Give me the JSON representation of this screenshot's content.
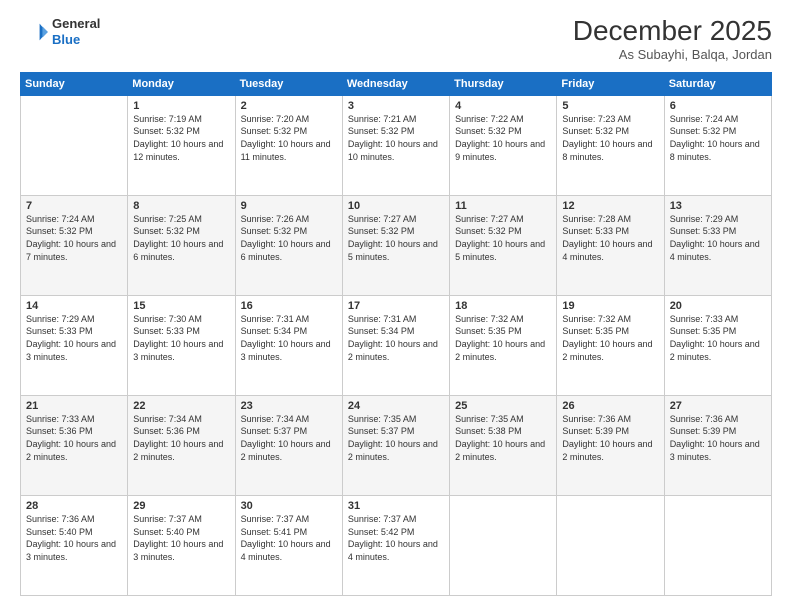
{
  "logo": {
    "line1": "General",
    "line2": "Blue"
  },
  "title": "December 2025",
  "location": "As Subayhi, Balqa, Jordan",
  "days_header": [
    "Sunday",
    "Monday",
    "Tuesday",
    "Wednesday",
    "Thursday",
    "Friday",
    "Saturday"
  ],
  "weeks": [
    [
      {
        "day": "",
        "sunrise": "",
        "sunset": "",
        "daylight": ""
      },
      {
        "day": "1",
        "sunrise": "7:19 AM",
        "sunset": "5:32 PM",
        "daylight": "10 hours and 12 minutes."
      },
      {
        "day": "2",
        "sunrise": "7:20 AM",
        "sunset": "5:32 PM",
        "daylight": "10 hours and 11 minutes."
      },
      {
        "day": "3",
        "sunrise": "7:21 AM",
        "sunset": "5:32 PM",
        "daylight": "10 hours and 10 minutes."
      },
      {
        "day": "4",
        "sunrise": "7:22 AM",
        "sunset": "5:32 PM",
        "daylight": "10 hours and 9 minutes."
      },
      {
        "day": "5",
        "sunrise": "7:23 AM",
        "sunset": "5:32 PM",
        "daylight": "10 hours and 8 minutes."
      },
      {
        "day": "6",
        "sunrise": "7:24 AM",
        "sunset": "5:32 PM",
        "daylight": "10 hours and 8 minutes."
      }
    ],
    [
      {
        "day": "7",
        "sunrise": "7:24 AM",
        "sunset": "5:32 PM",
        "daylight": "10 hours and 7 minutes."
      },
      {
        "day": "8",
        "sunrise": "7:25 AM",
        "sunset": "5:32 PM",
        "daylight": "10 hours and 6 minutes."
      },
      {
        "day": "9",
        "sunrise": "7:26 AM",
        "sunset": "5:32 PM",
        "daylight": "10 hours and 6 minutes."
      },
      {
        "day": "10",
        "sunrise": "7:27 AM",
        "sunset": "5:32 PM",
        "daylight": "10 hours and 5 minutes."
      },
      {
        "day": "11",
        "sunrise": "7:27 AM",
        "sunset": "5:32 PM",
        "daylight": "10 hours and 5 minutes."
      },
      {
        "day": "12",
        "sunrise": "7:28 AM",
        "sunset": "5:33 PM",
        "daylight": "10 hours and 4 minutes."
      },
      {
        "day": "13",
        "sunrise": "7:29 AM",
        "sunset": "5:33 PM",
        "daylight": "10 hours and 4 minutes."
      }
    ],
    [
      {
        "day": "14",
        "sunrise": "7:29 AM",
        "sunset": "5:33 PM",
        "daylight": "10 hours and 3 minutes."
      },
      {
        "day": "15",
        "sunrise": "7:30 AM",
        "sunset": "5:33 PM",
        "daylight": "10 hours and 3 minutes."
      },
      {
        "day": "16",
        "sunrise": "7:31 AM",
        "sunset": "5:34 PM",
        "daylight": "10 hours and 3 minutes."
      },
      {
        "day": "17",
        "sunrise": "7:31 AM",
        "sunset": "5:34 PM",
        "daylight": "10 hours and 2 minutes."
      },
      {
        "day": "18",
        "sunrise": "7:32 AM",
        "sunset": "5:35 PM",
        "daylight": "10 hours and 2 minutes."
      },
      {
        "day": "19",
        "sunrise": "7:32 AM",
        "sunset": "5:35 PM",
        "daylight": "10 hours and 2 minutes."
      },
      {
        "day": "20",
        "sunrise": "7:33 AM",
        "sunset": "5:35 PM",
        "daylight": "10 hours and 2 minutes."
      }
    ],
    [
      {
        "day": "21",
        "sunrise": "7:33 AM",
        "sunset": "5:36 PM",
        "daylight": "10 hours and 2 minutes."
      },
      {
        "day": "22",
        "sunrise": "7:34 AM",
        "sunset": "5:36 PM",
        "daylight": "10 hours and 2 minutes."
      },
      {
        "day": "23",
        "sunrise": "7:34 AM",
        "sunset": "5:37 PM",
        "daylight": "10 hours and 2 minutes."
      },
      {
        "day": "24",
        "sunrise": "7:35 AM",
        "sunset": "5:37 PM",
        "daylight": "10 hours and 2 minutes."
      },
      {
        "day": "25",
        "sunrise": "7:35 AM",
        "sunset": "5:38 PM",
        "daylight": "10 hours and 2 minutes."
      },
      {
        "day": "26",
        "sunrise": "7:36 AM",
        "sunset": "5:39 PM",
        "daylight": "10 hours and 2 minutes."
      },
      {
        "day": "27",
        "sunrise": "7:36 AM",
        "sunset": "5:39 PM",
        "daylight": "10 hours and 3 minutes."
      }
    ],
    [
      {
        "day": "28",
        "sunrise": "7:36 AM",
        "sunset": "5:40 PM",
        "daylight": "10 hours and 3 minutes."
      },
      {
        "day": "29",
        "sunrise": "7:37 AM",
        "sunset": "5:40 PM",
        "daylight": "10 hours and 3 minutes."
      },
      {
        "day": "30",
        "sunrise": "7:37 AM",
        "sunset": "5:41 PM",
        "daylight": "10 hours and 4 minutes."
      },
      {
        "day": "31",
        "sunrise": "7:37 AM",
        "sunset": "5:42 PM",
        "daylight": "10 hours and 4 minutes."
      },
      {
        "day": "",
        "sunrise": "",
        "sunset": "",
        "daylight": ""
      },
      {
        "day": "",
        "sunrise": "",
        "sunset": "",
        "daylight": ""
      },
      {
        "day": "",
        "sunrise": "",
        "sunset": "",
        "daylight": ""
      }
    ]
  ]
}
